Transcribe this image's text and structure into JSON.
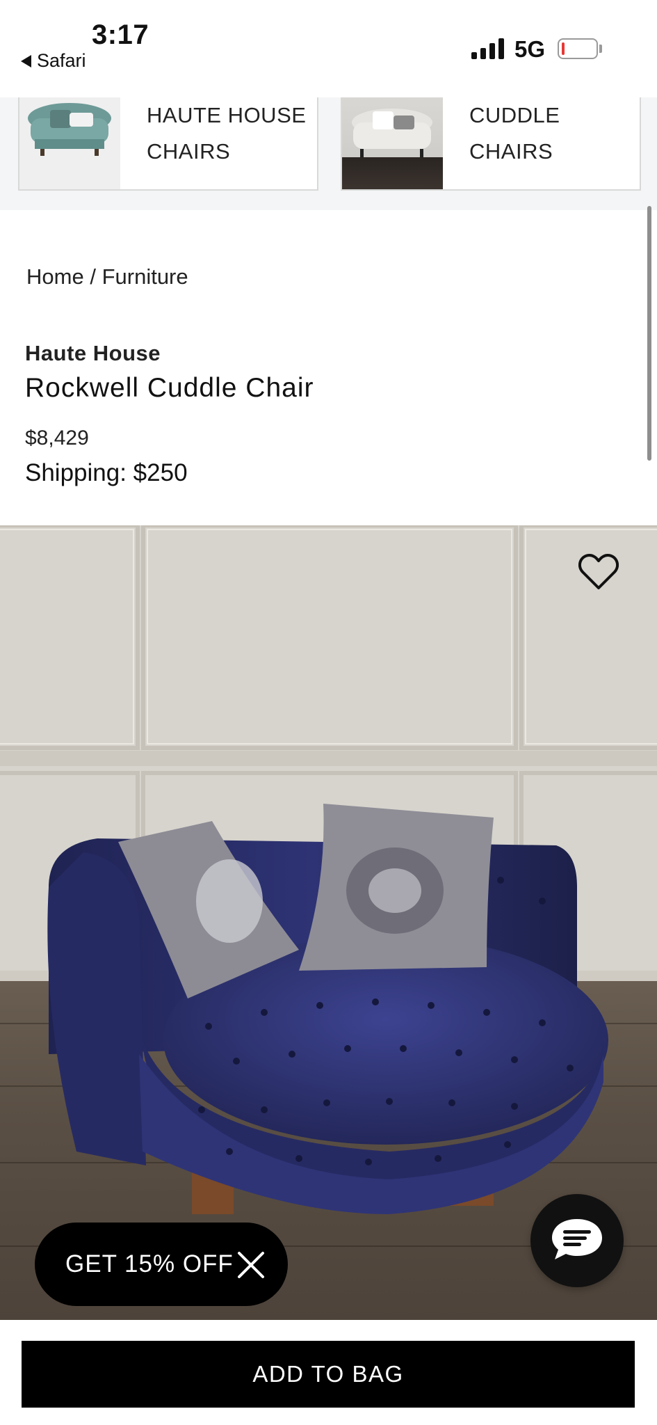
{
  "status_bar": {
    "time": "3:17",
    "back_app": "Safari",
    "network": "5G",
    "battery_color": "#e53935"
  },
  "categories": [
    {
      "label_line1": "HAUTE HOUSE",
      "label_line2": "CHAIRS",
      "icon": "teal-tufted-chair-thumbnail"
    },
    {
      "label_line1": "CUDDLE",
      "label_line2": "CHAIRS",
      "icon": "white-cuddle-chair-thumbnail"
    }
  ],
  "breadcrumb": {
    "home": "Home",
    "separator": "/",
    "current": "Furniture"
  },
  "product": {
    "brand": "Haute House",
    "name": "Rockwell Cuddle Chair",
    "price": "$8,429",
    "shipping": "Shipping: $250",
    "image_icon": "navy-tufted-cuddle-chair-photo",
    "sofa_color": "#2b2f6a"
  },
  "actions": {
    "favorite_icon": "heart-icon",
    "chat_icon": "chat-bubble-icon",
    "promo_label": "GET 15% OFF",
    "promo_close_icon": "close-icon",
    "add_to_bag": "ADD TO BAG"
  }
}
